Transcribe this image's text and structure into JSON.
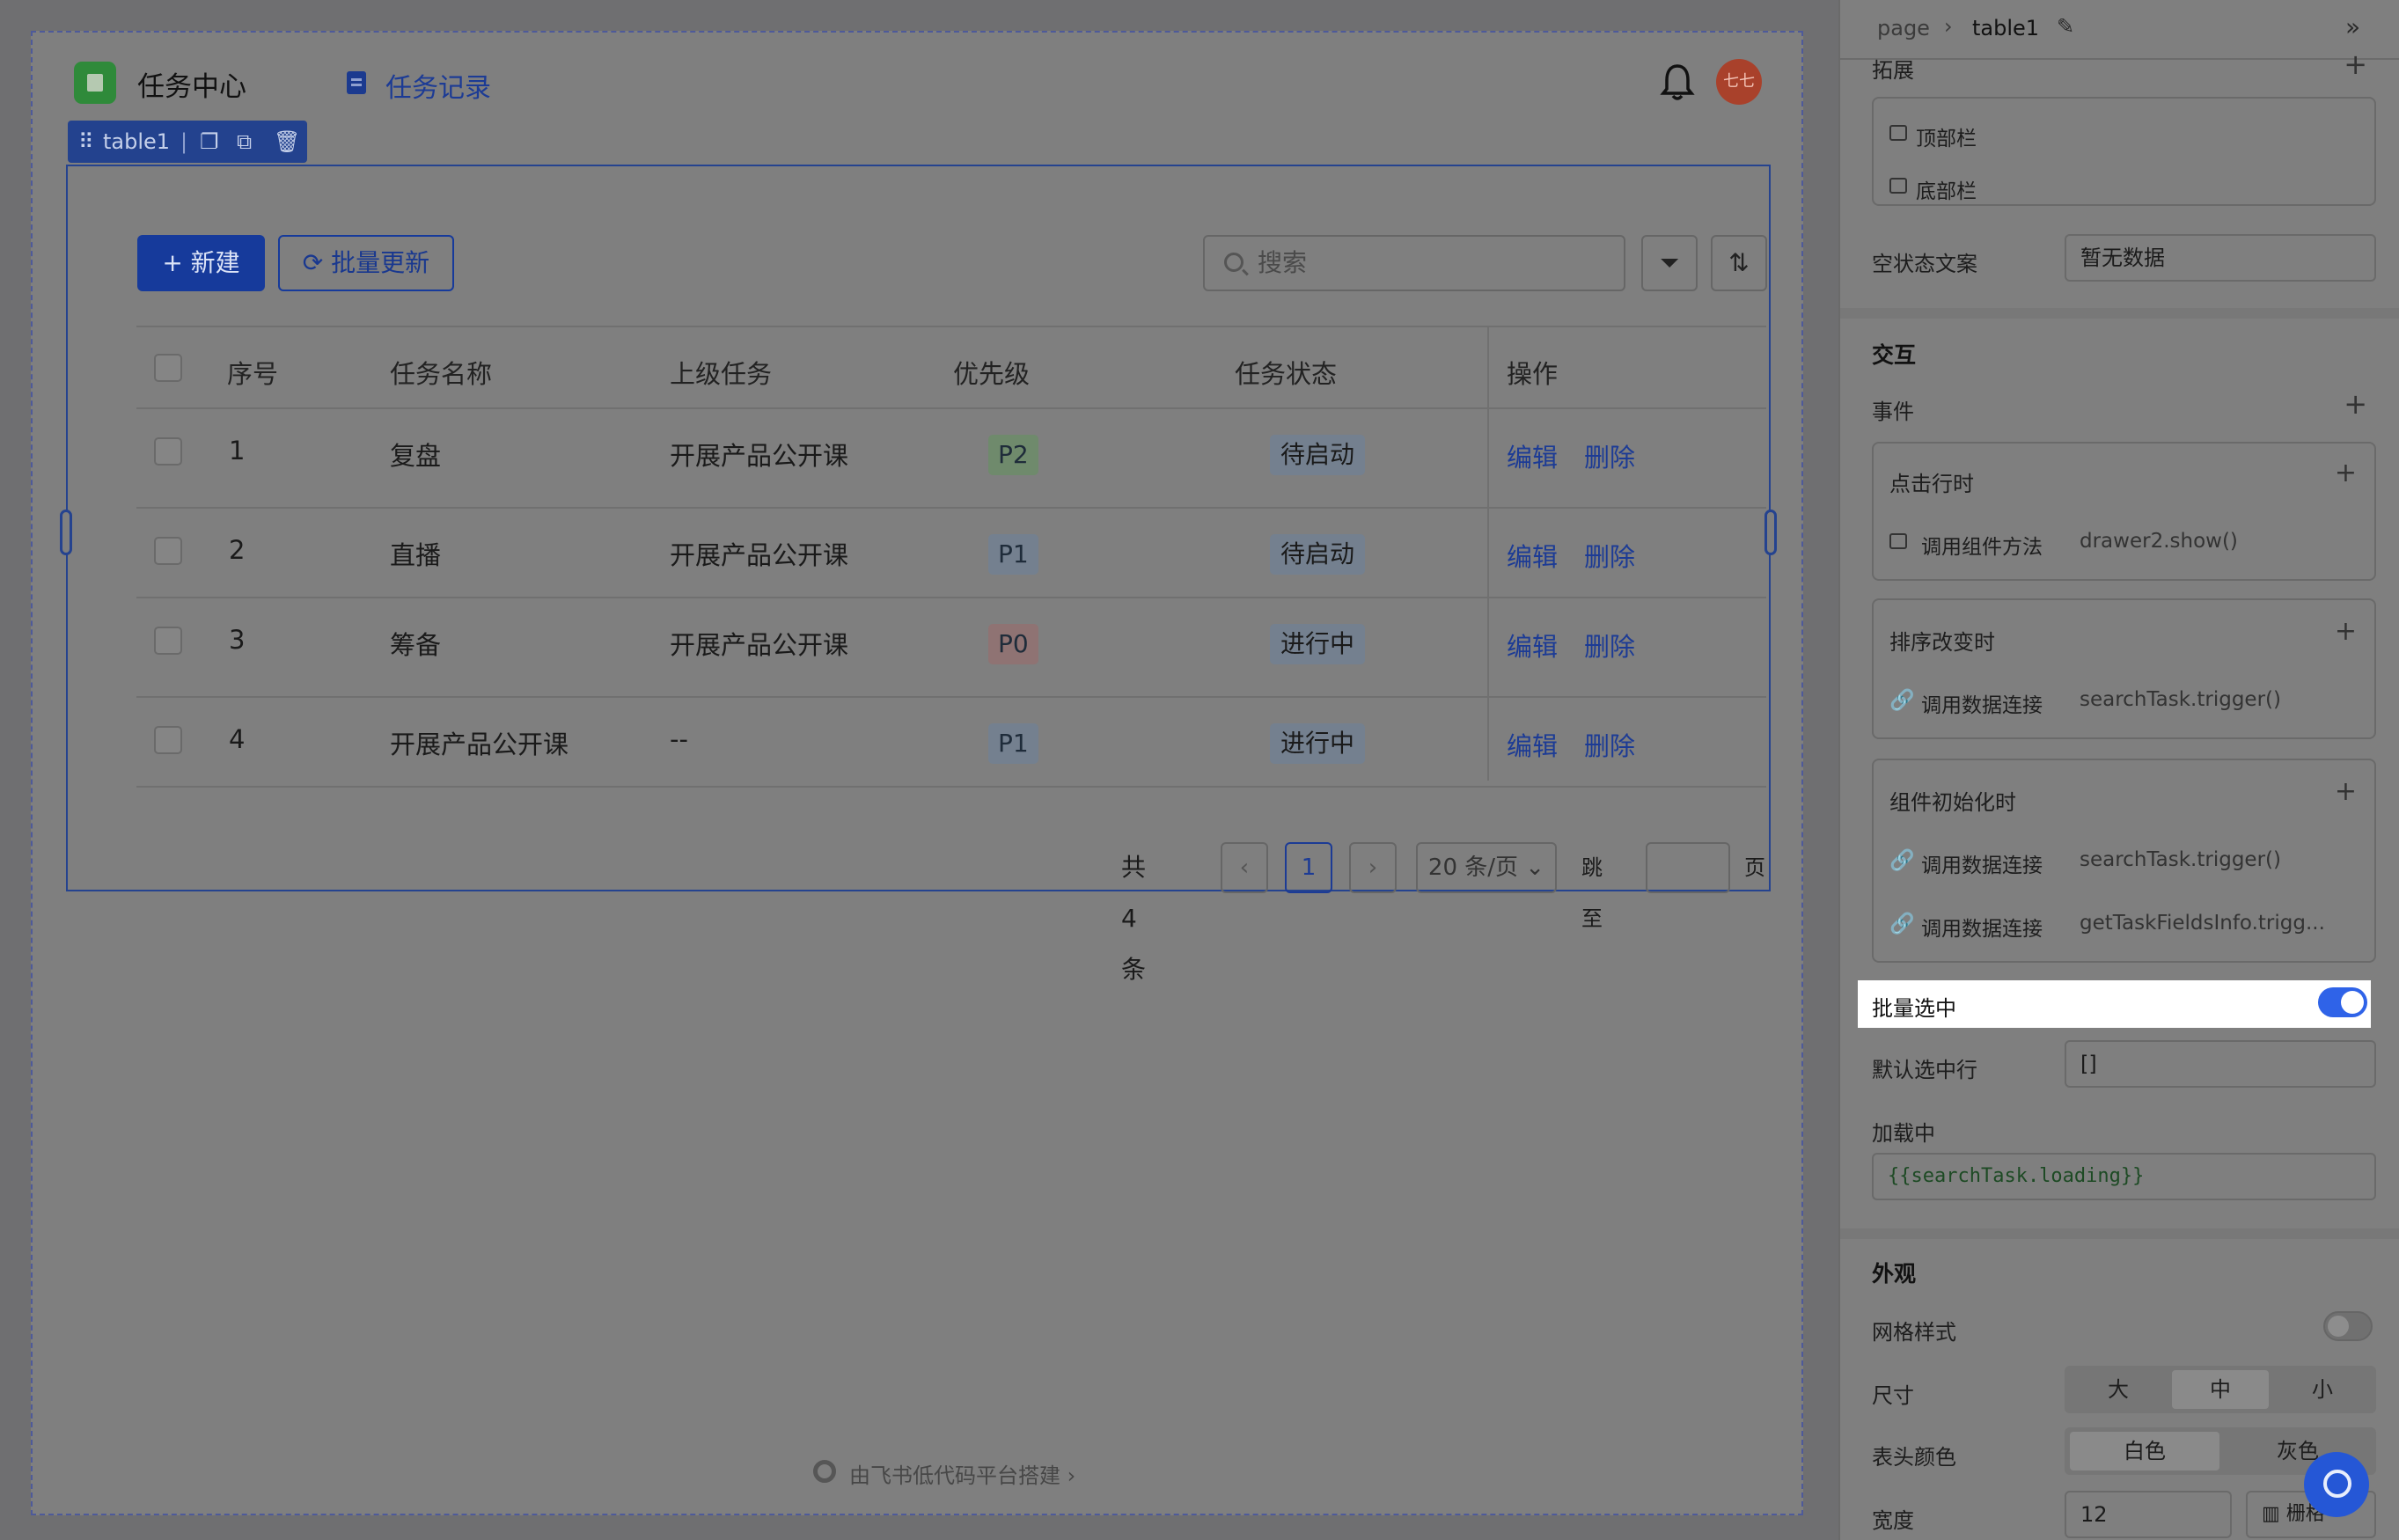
{
  "app": {
    "title": "任务中心",
    "nav_record": "任务记录",
    "avatar_text": "七七"
  },
  "selection": {
    "component_name": "table1"
  },
  "toolbar": {
    "new_label": "+ 新建",
    "batch_update_label": "批量更新",
    "search_placeholder": "搜索"
  },
  "table": {
    "columns": [
      "序号",
      "任务名称",
      "上级任务",
      "优先级",
      "任务状态",
      "操作"
    ],
    "rows": [
      {
        "index": "1",
        "name": "复盘",
        "parent": "开展产品公开课",
        "priority": "P2",
        "status": "待启动",
        "edit": "编辑",
        "delete": "删除"
      },
      {
        "index": "2",
        "name": "直播",
        "parent": "开展产品公开课",
        "priority": "P1",
        "status": "待启动",
        "edit": "编辑",
        "delete": "删除"
      },
      {
        "index": "3",
        "name": "筹备",
        "parent": "开展产品公开课",
        "priority": "P0",
        "status": "进行中",
        "edit": "编辑",
        "delete": "删除"
      },
      {
        "index": "4",
        "name": "开展产品公开课",
        "parent": "--",
        "priority": "P1",
        "status": "进行中",
        "edit": "编辑",
        "delete": "删除"
      }
    ],
    "priority_colors": {
      "P0": "#8f7373",
      "P1": "#74808f",
      "P2": "#6f8a6c"
    }
  },
  "pagination": {
    "total_text": "共 4 条",
    "current_page": "1",
    "page_size": "20 条/页",
    "jump_label": "跳至",
    "page_unit": "页"
  },
  "footer": {
    "powered_by": "由飞书低代码平台搭建"
  },
  "panel": {
    "breadcrumb_root": "page",
    "breadcrumb_current": "table1",
    "extend_section": "拓展",
    "top_bar": "顶部栏",
    "bottom_bar": "底部栏",
    "empty_text_label": "空状态文案",
    "empty_text_value": "暂无数据",
    "interaction_section": "交互",
    "events_label": "事件",
    "events": [
      {
        "title": "点击行时",
        "actions": [
          {
            "type": "调用组件方法",
            "value": "drawer2.show()"
          }
        ]
      },
      {
        "title": "排序改变时",
        "actions": [
          {
            "type": "调用数据连接",
            "value": "searchTask.trigger()"
          }
        ]
      },
      {
        "title": "组件初始化时",
        "actions": [
          {
            "type": "调用数据连接",
            "value": "searchTask.trigger()"
          },
          {
            "type": "调用数据连接",
            "value": "getTaskFieldsInfo.trigg..."
          }
        ]
      }
    ],
    "batch_select_label": "批量选中",
    "batch_select_on": true,
    "default_selected_label": "默认选中行",
    "default_selected_value": "[]",
    "loading_label": "加载中",
    "loading_value": "{{searchTask.loading}}",
    "appearance_section": "外观",
    "grid_style_label": "网格样式",
    "grid_style_on": false,
    "size_label": "尺寸",
    "size_options": [
      "大",
      "中",
      "小"
    ],
    "size_selected": "中",
    "header_color_label": "表头颜色",
    "header_color_options": [
      "白色",
      "灰色"
    ],
    "header_color_selected": "白色",
    "width_label": "宽度",
    "width_value": "12",
    "width_unit": "栅格"
  }
}
